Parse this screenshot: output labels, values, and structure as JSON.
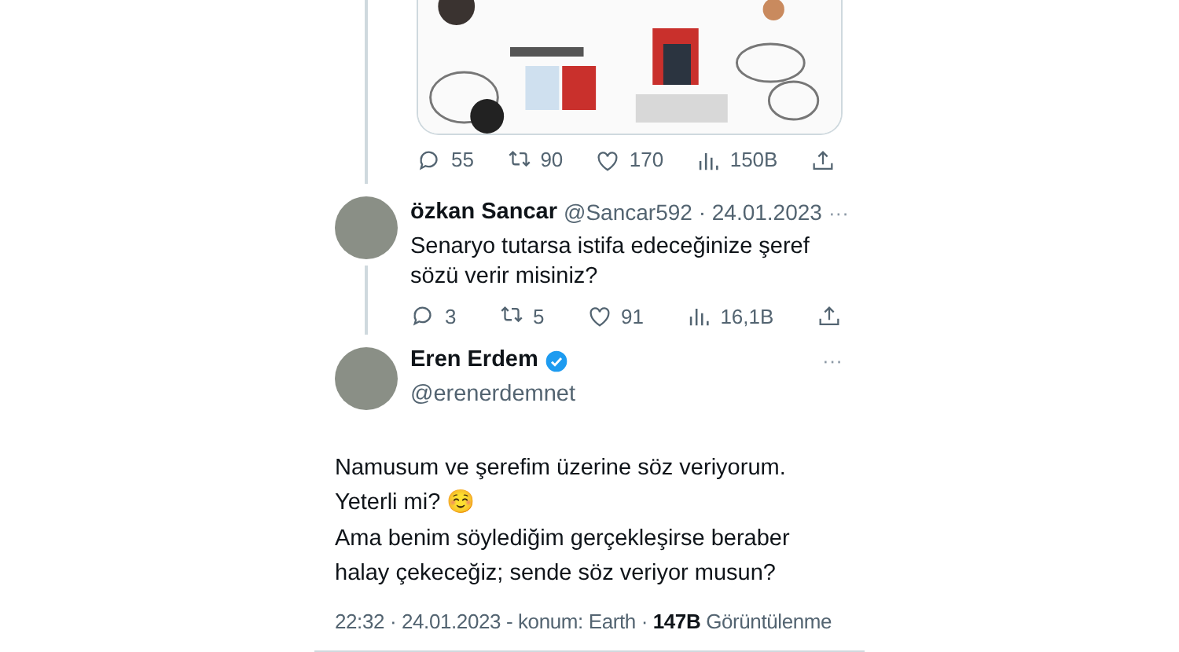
{
  "top_tweet": {
    "actions": [
      {
        "kind": "reply",
        "count": "55"
      },
      {
        "kind": "retweet",
        "count": "90"
      },
      {
        "kind": "like",
        "count": "170"
      },
      {
        "kind": "views",
        "count": "150B"
      },
      {
        "kind": "share"
      }
    ]
  },
  "reply_tweet": {
    "name": "özkan Sancar",
    "handle": "@Sancar592 · 24.01.2023",
    "more": "···",
    "text": "Senaryo tutarsa istifa edeceğinize şeref sözü verir misiniz?",
    "actions": [
      {
        "kind": "reply",
        "count": "3"
      },
      {
        "kind": "retweet",
        "count": "5"
      },
      {
        "kind": "like",
        "count": "91"
      },
      {
        "kind": "views",
        "count": "16,1B"
      },
      {
        "kind": "share"
      }
    ]
  },
  "main_tweet": {
    "name": "Eren Erdem",
    "verified": true,
    "handle": "@erenerdemnet",
    "more": "···",
    "text": "Namusum ve şerefim üzerine söz veriyorum.\nYeterli mi? ☺️\nAma benim söylediğim gerçekleşirse beraber halay çekeceğiz; sende söz veriyor musun?",
    "footer": "22:32 · 24.01.2023 - konum: Earth · **147B** Görüntülenme"
  }
}
